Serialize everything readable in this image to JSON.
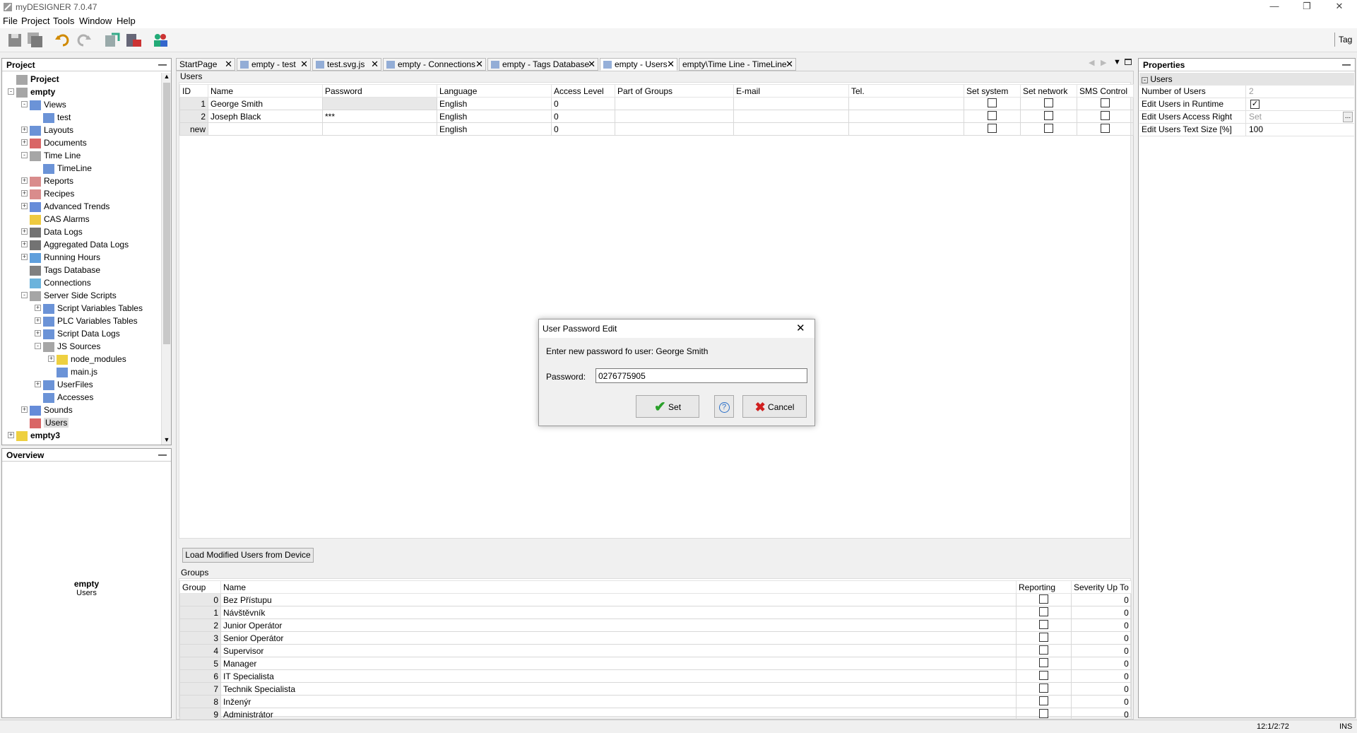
{
  "window": {
    "title": "myDESIGNER 7.0.47"
  },
  "menu": [
    "File",
    "Project",
    "Tools",
    "Window",
    "Help"
  ],
  "toolbar": {
    "right_label": "Tag"
  },
  "project_panel": {
    "title": "Project",
    "tree": [
      {
        "label": "Project",
        "level": 0,
        "bold": true
      },
      {
        "label": "empty",
        "level": 0,
        "bold": true,
        "expander": "-"
      },
      {
        "label": "Views",
        "level": 1,
        "expander": "-"
      },
      {
        "label": "test",
        "level": 2
      },
      {
        "label": "Layouts",
        "level": 1,
        "expander": "+"
      },
      {
        "label": "Documents",
        "level": 1,
        "expander": "+"
      },
      {
        "label": "Time Line",
        "level": 1,
        "expander": "-"
      },
      {
        "label": "TimeLine",
        "level": 2
      },
      {
        "label": "Reports",
        "level": 1,
        "expander": "+"
      },
      {
        "label": "Recipes",
        "level": 1,
        "expander": "+"
      },
      {
        "label": "Advanced Trends",
        "level": 1,
        "expander": "+"
      },
      {
        "label": "CAS Alarms",
        "level": 1
      },
      {
        "label": "Data Logs",
        "level": 1,
        "expander": "+"
      },
      {
        "label": "Aggregated Data Logs",
        "level": 1,
        "expander": "+"
      },
      {
        "label": "Running Hours",
        "level": 1,
        "expander": "+"
      },
      {
        "label": "Tags Database",
        "level": 1
      },
      {
        "label": "Connections",
        "level": 1
      },
      {
        "label": "Server Side Scripts",
        "level": 1,
        "expander": "-"
      },
      {
        "label": "Script Variables Tables",
        "level": 2,
        "expander": "+"
      },
      {
        "label": "PLC Variables Tables",
        "level": 2,
        "expander": "+"
      },
      {
        "label": "Script Data Logs",
        "level": 2,
        "expander": "+"
      },
      {
        "label": "JS Sources",
        "level": 2,
        "expander": "-"
      },
      {
        "label": "node_modules",
        "level": 3,
        "expander": "+"
      },
      {
        "label": "main.js",
        "level": 3
      },
      {
        "label": "UserFiles",
        "level": 2,
        "expander": "+"
      },
      {
        "label": "Accesses",
        "level": 2
      },
      {
        "label": "Sounds",
        "level": 1,
        "expander": "+"
      },
      {
        "label": "Users",
        "level": 1,
        "selected": true
      },
      {
        "label": "empty3",
        "level": 0,
        "bold": true,
        "expander": "+"
      }
    ]
  },
  "overview_panel": {
    "title": "Overview",
    "name": "empty",
    "sub": "Users"
  },
  "tabs": [
    {
      "label": "StartPage",
      "active": false
    },
    {
      "label": "empty - test",
      "active": false
    },
    {
      "label": "test.svg.js",
      "active": false
    },
    {
      "label": "empty - Connections",
      "active": false
    },
    {
      "label": "empty - Tags Database",
      "active": false
    },
    {
      "label": "empty - Users",
      "active": true
    },
    {
      "label": "empty\\Time Line - TimeLine",
      "active": false
    }
  ],
  "users": {
    "section_label": "Users",
    "columns": [
      "ID",
      "Name",
      "Password",
      "Language",
      "Access Level",
      "Part of Groups",
      "E-mail",
      "Tel.",
      "Set system",
      "Set network",
      "SMS Control"
    ],
    "rows": [
      {
        "id": "1",
        "name": "George Smith",
        "password": "",
        "language": "English",
        "access": "0"
      },
      {
        "id": "2",
        "name": "Joseph Black",
        "password": "***",
        "language": "English",
        "access": "0"
      },
      {
        "id": "new",
        "name": "",
        "password": "",
        "language": "English",
        "access": "0"
      }
    ],
    "load_button": "Load Modified Users from Device"
  },
  "groups": {
    "section_label": "Groups",
    "columns": [
      "Group",
      "Name",
      "Reporting",
      "Severity Up To"
    ],
    "rows": [
      {
        "group": "0",
        "name": "Bez Přístupu",
        "severity": "0"
      },
      {
        "group": "1",
        "name": "Návštěvník",
        "severity": "0"
      },
      {
        "group": "2",
        "name": "Junior Operátor",
        "severity": "0"
      },
      {
        "group": "3",
        "name": "Senior Operátor",
        "severity": "0"
      },
      {
        "group": "4",
        "name": "Supervisor",
        "severity": "0"
      },
      {
        "group": "5",
        "name": "Manager",
        "severity": "0"
      },
      {
        "group": "6",
        "name": "IT Specialista",
        "severity": "0"
      },
      {
        "group": "7",
        "name": "Technik Specialista",
        "severity": "0"
      },
      {
        "group": "8",
        "name": "Inženýr",
        "severity": "0"
      },
      {
        "group": "9",
        "name": "Administrátor",
        "severity": "0"
      }
    ]
  },
  "properties_panel": {
    "title": "Properties",
    "section": "Users",
    "rows": [
      {
        "name": "Number of Users",
        "value": "2"
      },
      {
        "name": "Edit Users in Runtime",
        "value": "",
        "checkbox": true
      },
      {
        "name": "Edit Users Access Right",
        "value": "Set",
        "ellipsis": true
      },
      {
        "name": "Edit Users Text Size [%]",
        "value": "100"
      }
    ]
  },
  "dialog": {
    "title": "User Password Edit",
    "prompt": "Enter new password fo user:  George Smith",
    "password_label": "Password:",
    "password_value": "0276775905",
    "set_label": "Set",
    "help_label": "?",
    "cancel_label": "Cancel"
  },
  "status": {
    "position": "12:1/2:72",
    "mode": "INS"
  }
}
